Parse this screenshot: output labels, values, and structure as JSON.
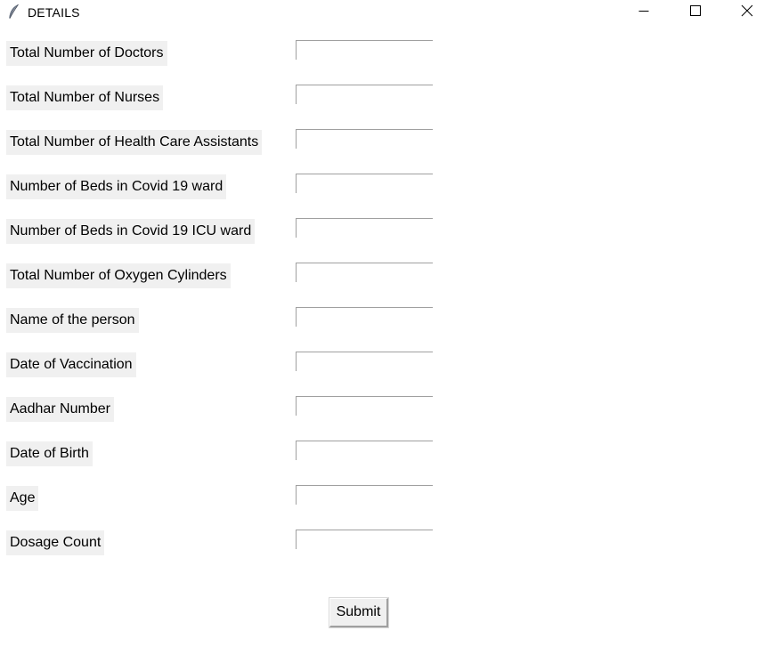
{
  "window": {
    "title": "DETAILS",
    "app_icon": "feather-icon",
    "controls": {
      "minimize_icon": "minimize-icon",
      "maximize_icon": "maximize-icon",
      "close_icon": "close-icon"
    }
  },
  "form": {
    "fields": [
      {
        "label": "Total Number of Doctors",
        "value": ""
      },
      {
        "label": "Total Number of Nurses",
        "value": ""
      },
      {
        "label": "Total Number of Health Care Assistants",
        "value": ""
      },
      {
        "label": "Number of Beds in Covid 19 ward",
        "value": ""
      },
      {
        "label": "Number of Beds in Covid 19 ICU ward",
        "value": ""
      },
      {
        "label": "Total Number of Oxygen Cylinders",
        "value": ""
      },
      {
        "label": "Name of the person",
        "value": ""
      },
      {
        "label": "Date of Vaccination",
        "value": ""
      },
      {
        "label": "Aadhar Number",
        "value": ""
      },
      {
        "label": "Date of Birth",
        "value": ""
      },
      {
        "label": "Age",
        "value": ""
      },
      {
        "label": "Dosage Count",
        "value": ""
      }
    ],
    "submit_label": "Submit"
  },
  "colors": {
    "label_background": "#f0f0f0",
    "window_background": "#ffffff",
    "input_border": "#a0a0a0"
  }
}
